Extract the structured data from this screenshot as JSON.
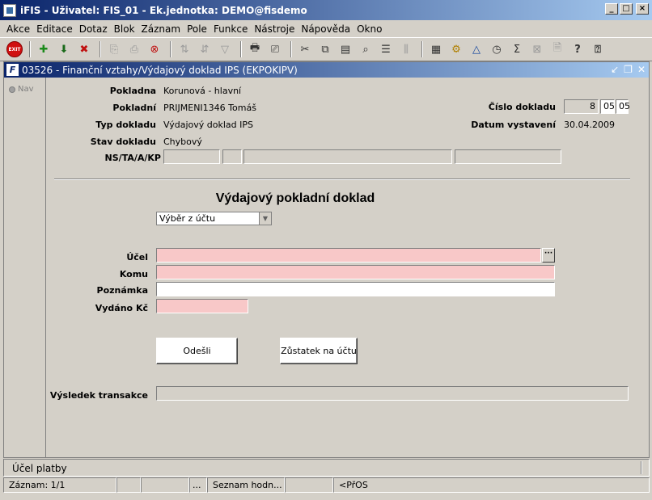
{
  "window": {
    "title": "iFIS - Uživatel: FIS_01 - Ek.jednotka: DEMO@fisdemo"
  },
  "menu": [
    "Akce",
    "Editace",
    "Dotaz",
    "Blok",
    "Záznam",
    "Pole",
    "Funkce",
    "Nástroje",
    "Nápověda",
    "Okno"
  ],
  "toolbar": {
    "exit_label": "EXIT"
  },
  "form": {
    "title": "03526 - Finanční vztahy/Výdajový doklad IPS (EKPOKIPV)",
    "nav_label": "Nav",
    "pokladna": {
      "label": "Pokladna",
      "value": "Korunová - hlavní"
    },
    "pokladni": {
      "label": "Pokladní",
      "value": "PRIJMENI1346 Tomáš"
    },
    "typ_dokladu": {
      "label": "Typ dokladu",
      "value": "Výdajový doklad IPS"
    },
    "stav_dokladu": {
      "label": "Stav dokladu",
      "value": "Chybový"
    },
    "ns_label": "NS/TA/A/KP",
    "cislo_dokladu": {
      "label": "Číslo dokladu",
      "part1": "8",
      "part2": "05",
      "part3": "05"
    },
    "datum_vystaveni": {
      "label": "Datum vystavení",
      "value": "30.04.2009"
    },
    "heading": "Výdajový pokladní doklad",
    "select_value": "Výběr z účtu",
    "ucel_label": "Účel",
    "komu_label": "Komu",
    "poznamka_label": "Poznámka",
    "vydano_label": "Vydáno Kč",
    "send_button": "Odešli",
    "balance_button": "Zůstatek na účtu",
    "result_label": "Výsledek transakce"
  },
  "status": {
    "hint": "Účel platby",
    "record": "Záznam: 1/1",
    "dots": "...",
    "list": "Seznam hodn...",
    "mode": "<PřOS"
  }
}
